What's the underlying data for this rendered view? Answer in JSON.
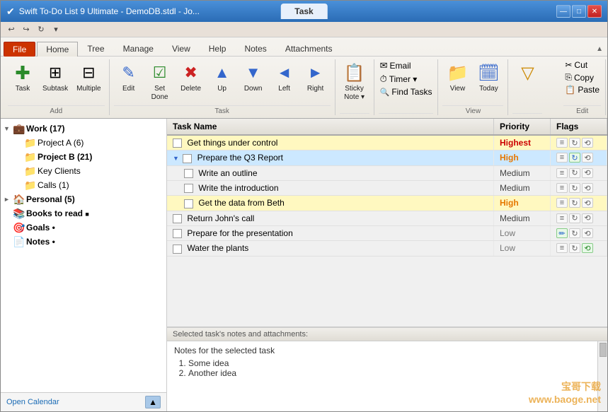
{
  "window": {
    "title": "Swift To-Do List 9 Ultimate - DemoDB.stdl - Jo...",
    "title_tab": "Task"
  },
  "quick_access": {
    "buttons": [
      "↩",
      "↪",
      "↻"
    ]
  },
  "ribbon": {
    "tabs": [
      "File",
      "Home",
      "Tree",
      "Manage",
      "View",
      "Help",
      "Notes",
      "Attachments"
    ],
    "active_tab": "Home",
    "groups": {
      "add": {
        "label": "Add",
        "buttons": [
          {
            "id": "task",
            "label": "Task",
            "icon": "✚"
          },
          {
            "id": "subtask",
            "label": "Subtask",
            "icon": "⊞"
          },
          {
            "id": "multiple",
            "label": "Multiple",
            "icon": "⊟"
          }
        ]
      },
      "task": {
        "label": "Task",
        "buttons": [
          {
            "id": "edit",
            "label": "Edit",
            "icon": "✎"
          },
          {
            "id": "set-done",
            "label": "Set\nDone",
            "icon": "☑"
          },
          {
            "id": "delete",
            "label": "Delete",
            "icon": "✖"
          },
          {
            "id": "up",
            "label": "Up",
            "icon": "▲"
          },
          {
            "id": "down",
            "label": "Down",
            "icon": "▼"
          },
          {
            "id": "left",
            "label": "Left",
            "icon": "◄"
          },
          {
            "id": "right",
            "label": "Right",
            "icon": "►"
          }
        ]
      },
      "sticky": {
        "label": "",
        "buttons": [
          {
            "id": "sticky-note",
            "label": "Sticky\nNote",
            "icon": "📋"
          }
        ]
      },
      "find": {
        "label": "",
        "items": [
          {
            "id": "email",
            "label": "Email",
            "icon": "✉"
          },
          {
            "id": "timer",
            "label": "Timer",
            "icon": "⏱"
          },
          {
            "id": "find-tasks",
            "label": "Find Tasks",
            "icon": "🔍"
          }
        ]
      },
      "view": {
        "label": "View",
        "buttons": [
          {
            "id": "view",
            "label": "View",
            "icon": "📁"
          },
          {
            "id": "today",
            "label": "Today",
            "icon": "🗓"
          }
        ]
      },
      "edit": {
        "label": "Edit",
        "items": [
          {
            "id": "cut",
            "label": "Cut",
            "icon": "✂"
          },
          {
            "id": "copy",
            "label": "Copy",
            "icon": "⎘"
          },
          {
            "id": "paste",
            "label": "Paste",
            "icon": "📋"
          }
        ]
      }
    }
  },
  "sidebar": {
    "open_calendar_label": "Open Calendar",
    "items": [
      {
        "id": "work",
        "label": "Work (17)",
        "level": 0,
        "icon": "💼",
        "arrow": "▼",
        "has_arrow": true
      },
      {
        "id": "project-a",
        "label": "Project A (6)",
        "level": 1,
        "icon": "📁",
        "arrow": "",
        "has_arrow": false
      },
      {
        "id": "project-b",
        "label": "Project B (21)",
        "level": 1,
        "icon": "📁",
        "arrow": "",
        "has_arrow": false
      },
      {
        "id": "key-clients",
        "label": "Key Clients",
        "level": 1,
        "icon": "📁",
        "arrow": "",
        "has_arrow": false
      },
      {
        "id": "calls",
        "label": "Calls (1)",
        "level": 1,
        "icon": "📁",
        "arrow": "",
        "has_arrow": false
      },
      {
        "id": "personal",
        "label": "Personal (5)",
        "level": 0,
        "icon": "🏠",
        "arrow": "►",
        "has_arrow": true
      },
      {
        "id": "books",
        "label": "Books to read",
        "level": 0,
        "icon": "📚",
        "arrow": "",
        "has_arrow": false
      },
      {
        "id": "goals",
        "label": "Goals •",
        "level": 0,
        "icon": "🎯",
        "arrow": "",
        "has_arrow": false
      },
      {
        "id": "notes",
        "label": "Notes •",
        "level": 0,
        "icon": "📄",
        "arrow": "",
        "has_arrow": false
      }
    ]
  },
  "task_table": {
    "columns": [
      "Task Name",
      "Priority",
      "Flags"
    ],
    "rows": [
      {
        "id": 1,
        "name": "Get things under control",
        "priority": "Highest",
        "priority_class": "priority-highest",
        "indent": 0,
        "checked": false,
        "row_class": "task-row-highlight",
        "flags": [
          "note",
          "sync",
          "repeat"
        ]
      },
      {
        "id": 2,
        "name": "Prepare the Q3 Report",
        "priority": "High",
        "priority_class": "priority-high",
        "indent": 0,
        "checked": false,
        "row_class": "task-row-selected",
        "flags": [
          "note",
          "sync-active",
          "repeat"
        ]
      },
      {
        "id": 3,
        "name": "Write an outline",
        "priority": "Medium",
        "priority_class": "priority-medium",
        "indent": 1,
        "checked": false,
        "row_class": "",
        "flags": [
          "note",
          "sync",
          "repeat"
        ]
      },
      {
        "id": 4,
        "name": "Write the introduction",
        "priority": "Medium",
        "priority_class": "priority-medium",
        "indent": 1,
        "checked": false,
        "row_class": "",
        "flags": [
          "note",
          "sync",
          "repeat"
        ]
      },
      {
        "id": 5,
        "name": "Get the data from Beth",
        "priority": "High",
        "priority_class": "priority-high",
        "indent": 1,
        "checked": false,
        "row_class": "task-row-highlight",
        "flags": [
          "note",
          "sync",
          "repeat"
        ]
      },
      {
        "id": 6,
        "name": "Return John's call",
        "priority": "Medium",
        "priority_class": "priority-medium",
        "indent": 0,
        "checked": false,
        "row_class": "",
        "flags": [
          "note",
          "sync",
          "repeat"
        ]
      },
      {
        "id": 7,
        "name": "Prepare for the presentation",
        "priority": "Low",
        "priority_class": "priority-low",
        "indent": 0,
        "checked": false,
        "row_class": "",
        "flags": [
          "note-active",
          "sync",
          "repeat"
        ]
      },
      {
        "id": 8,
        "name": "Water the plants",
        "priority": "Low",
        "priority_class": "priority-low",
        "indent": 0,
        "checked": false,
        "row_class": "",
        "flags": [
          "note",
          "sync",
          "repeat-active"
        ]
      }
    ]
  },
  "notes": {
    "header": "Selected task's notes and attachments:",
    "content_title": "Notes for the selected task",
    "items": [
      "Some idea",
      "Another idea"
    ]
  },
  "watermark": "宝哥下载\nwww.baoge.net"
}
